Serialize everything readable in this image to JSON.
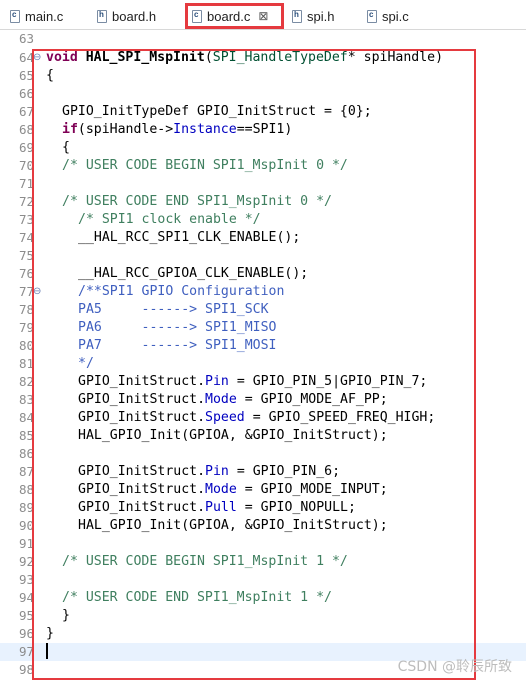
{
  "tabs": [
    {
      "label": "main.c",
      "icon": "c"
    },
    {
      "label": "board.h",
      "icon": "h"
    },
    {
      "label": "board.c",
      "icon": "c",
      "active": true,
      "close": "⊠"
    },
    {
      "label": "spi.h",
      "icon": "h"
    },
    {
      "label": "spi.c",
      "icon": "c"
    }
  ],
  "line_numbers": [
    "63",
    "64",
    "65",
    "66",
    "67",
    "68",
    "69",
    "70",
    "71",
    "72",
    "73",
    "74",
    "75",
    "76",
    "77",
    "78",
    "79",
    "80",
    "81",
    "82",
    "83",
    "84",
    "85",
    "86",
    "87",
    "88",
    "89",
    "90",
    "91",
    "92",
    "93",
    "94",
    "95",
    "96",
    "97",
    "98"
  ],
  "code": {
    "l64_kw": "void",
    "l64_fn": "HAL_SPI_MspInit",
    "l64_open": "(",
    "l64_type": "SPI_HandleTypeDef",
    "l64_rest": "* spiHandle)",
    "l65": "{",
    "l67": "GPIO_InitTypeDef GPIO_InitStruct = {0};",
    "l68_kw": "if",
    "l68_a": "(spiHandle->",
    "l68_fld": "Instance",
    "l68_b": "==SPI1)",
    "l69": "{",
    "l70": "/* USER CODE BEGIN SPI1_MspInit 0 */",
    "l72": "/* USER CODE END SPI1_MspInit 0 */",
    "l73": "/* SPI1 clock enable */",
    "l74": "__HAL_RCC_SPI1_CLK_ENABLE();",
    "l76": "__HAL_RCC_GPIOA_CLK_ENABLE();",
    "l77": "/**SPI1 GPIO Configuration",
    "l78": "PA5     ------> SPI1_SCK",
    "l79": "PA6     ------> SPI1_MISO",
    "l80": "PA7     ------> SPI1_MOSI",
    "l81": "*/",
    "l82_a": "GPIO_InitStruct.",
    "l82_f": "Pin",
    "l82_b": " = GPIO_PIN_5|GPIO_PIN_7;",
    "l83_a": "GPIO_InitStruct.",
    "l83_f": "Mode",
    "l83_b": " = GPIO_MODE_AF_PP;",
    "l84_a": "GPIO_InitStruct.",
    "l84_f": "Speed",
    "l84_b": " = GPIO_SPEED_FREQ_HIGH;",
    "l85": "HAL_GPIO_Init(GPIOA, &GPIO_InitStruct);",
    "l87_a": "GPIO_InitStruct.",
    "l87_f": "Pin",
    "l87_b": " = GPIO_PIN_6;",
    "l88_a": "GPIO_InitStruct.",
    "l88_f": "Mode",
    "l88_b": " = GPIO_MODE_INPUT;",
    "l89_a": "GPIO_InitStruct.",
    "l89_f": "Pull",
    "l89_b": " = GPIO_NOPULL;",
    "l90": "HAL_GPIO_Init(GPIOA, &GPIO_InitStruct);",
    "l92": "/* USER CODE BEGIN SPI1_MspInit 1 */",
    "l94": "/* USER CODE END SPI1_MspInit 1 */",
    "l95": "}",
    "l96": "}"
  },
  "fold_marker": "⊖",
  "watermark": "CSDN @聆辰所致",
  "colors": {
    "highlight_box": "#e53a3f",
    "keyword": "#7f0055",
    "comment": "#3f7f5f",
    "javadoc": "#3f5fbf",
    "field": "#0000c0"
  }
}
